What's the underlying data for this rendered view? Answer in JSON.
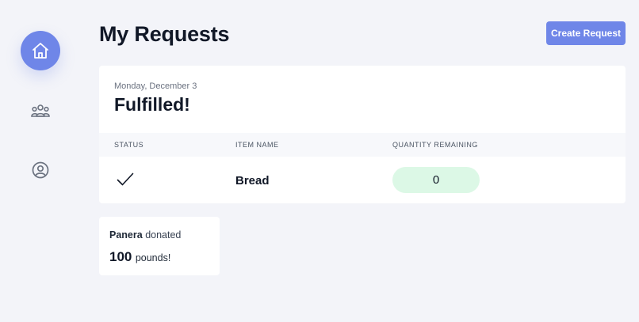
{
  "sidebar": {
    "items": [
      {
        "icon": "home-icon",
        "active": true
      },
      {
        "icon": "group-icon",
        "active": false
      },
      {
        "icon": "user-circle-icon",
        "active": false
      }
    ]
  },
  "header": {
    "title": "My Requests",
    "create_button_label": "Create Request"
  },
  "request_card": {
    "date": "Monday, December 3",
    "status_title": "Fulfilled!",
    "columns": [
      "STATUS",
      "ITEM NAME",
      "QUANTITY REMAINING"
    ],
    "row": {
      "status_icon": "checkmark-icon",
      "item_name": "Bread",
      "quantity_remaining": "0"
    }
  },
  "donation": {
    "donor": "Panera",
    "verb": "donated",
    "amount": "100",
    "unit": "pounds!"
  },
  "colors": {
    "accent": "#6f86e8",
    "background": "#f3f4f9",
    "quantity_pill": "#dcf8e6"
  }
}
